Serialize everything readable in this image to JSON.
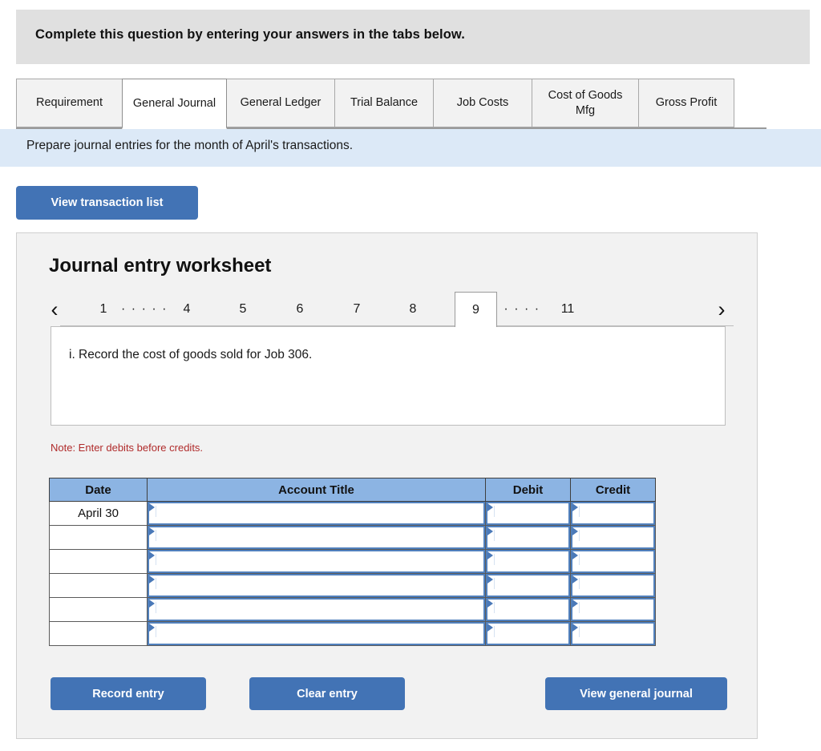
{
  "banner": {
    "text": "Complete this question by entering your answers in the tabs below."
  },
  "tabs": [
    {
      "label": "Requirement",
      "active": false
    },
    {
      "label": "General Journal",
      "active": true
    },
    {
      "label": "General Ledger",
      "active": false
    },
    {
      "label": "Trial Balance",
      "active": false
    },
    {
      "label": "Job Costs",
      "active": false
    },
    {
      "label": "Cost of Goods Mfg",
      "active": false
    },
    {
      "label": "Gross Profit",
      "active": false
    }
  ],
  "instruction": {
    "text": "Prepare journal entries for the month of April's transactions."
  },
  "toolbar": {
    "view_transaction_list_label": "View transaction list"
  },
  "worksheet": {
    "title": "Journal entry worksheet",
    "pager": {
      "prev_icon": "‹",
      "next_icon": "›",
      "items": [
        {
          "type": "page",
          "label": "1",
          "active": false
        },
        {
          "type": "ellipsis",
          "label": "· · · · ·"
        },
        {
          "type": "page",
          "label": "4",
          "active": false
        },
        {
          "type": "page",
          "label": "5",
          "active": false
        },
        {
          "type": "page",
          "label": "6",
          "active": false
        },
        {
          "type": "page",
          "label": "7",
          "active": false
        },
        {
          "type": "page",
          "label": "8",
          "active": false
        },
        {
          "type": "page",
          "label": "9",
          "active": true
        },
        {
          "type": "ellipsis",
          "label": "· · · ·"
        },
        {
          "type": "page",
          "label": "11",
          "active": false
        }
      ]
    },
    "prompt": "i. Record the cost of goods sold for Job 306.",
    "note": "Note: Enter debits before credits.",
    "table": {
      "headers": [
        "Date",
        "Account Title",
        "Debit",
        "Credit"
      ],
      "rows": [
        {
          "date": "April 30",
          "account_title": "",
          "debit": "",
          "credit": ""
        },
        {
          "date": "",
          "account_title": "",
          "debit": "",
          "credit": ""
        },
        {
          "date": "",
          "account_title": "",
          "debit": "",
          "credit": ""
        },
        {
          "date": "",
          "account_title": "",
          "debit": "",
          "credit": ""
        },
        {
          "date": "",
          "account_title": "",
          "debit": "",
          "credit": ""
        },
        {
          "date": "",
          "account_title": "",
          "debit": "",
          "credit": ""
        }
      ]
    },
    "actions": {
      "record_entry_label": "Record entry",
      "clear_entry_label": "Clear entry",
      "view_general_journal_label": "View general journal"
    }
  },
  "colors": {
    "accent_blue": "#4273b5",
    "table_header_blue": "#8cb4e3",
    "instruction_blue": "#dce9f7",
    "banner_gray": "#e0e0e0",
    "panel_gray": "#f2f2f2",
    "note_red": "#b02b2b",
    "input_border_blue": "#5080bd"
  }
}
